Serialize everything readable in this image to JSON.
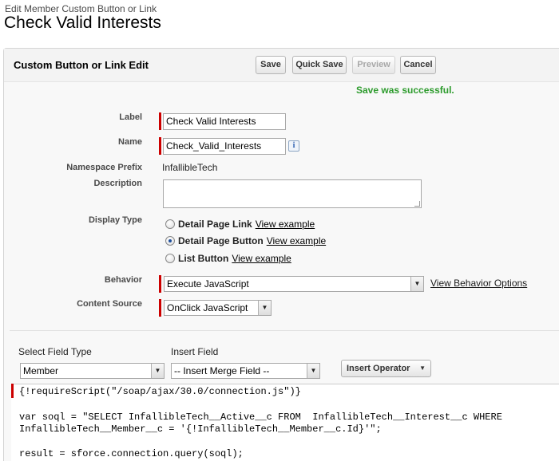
{
  "header": {
    "breadcrumb": "Edit Member Custom Button or Link",
    "title": "Check Valid Interests"
  },
  "panel": {
    "title": "Custom Button or Link Edit",
    "buttons": {
      "save": "Save",
      "quick_save": "Quick Save",
      "preview": "Preview",
      "cancel": "Cancel"
    },
    "success_message": "Save was successful."
  },
  "form": {
    "label": {
      "label": "Label",
      "value": "Check Valid Interests"
    },
    "name": {
      "label": "Name",
      "value": "Check_Valid_Interests",
      "info_icon": "info-icon"
    },
    "namespace": {
      "label": "Namespace Prefix",
      "value": "InfallibleTech"
    },
    "description": {
      "label": "Description",
      "value": ""
    },
    "display_type": {
      "label": "Display Type",
      "options": [
        {
          "label": "Detail Page Link",
          "link": "View example",
          "checked": false
        },
        {
          "label": "Detail Page Button",
          "link": "View example",
          "checked": true
        },
        {
          "label": "List Button",
          "link": "View example",
          "checked": false
        }
      ]
    },
    "behavior": {
      "label": "Behavior",
      "value": "Execute JavaScript",
      "link": "View Behavior Options"
    },
    "content_source": {
      "label": "Content Source",
      "value": "OnClick JavaScript"
    }
  },
  "editor_toolbar": {
    "select_field_type_label": "Select Field Type",
    "select_field_type_value": "Member",
    "insert_field_label": "Insert Field",
    "insert_field_value": "-- Insert Merge Field --",
    "insert_operator": "Insert Operator"
  },
  "code": {
    "lines": [
      "{!requireScript(\"/soap/ajax/30.0/connection.js\")}",
      "",
      "var soql = \"SELECT InfallibleTech__Active__c FROM  InfallibleTech__Interest__c WHERE",
      "InfallibleTech__Member__c = '{!InfallibleTech__Member__c.Id}'\";",
      "",
      "result = sforce.connection.query(soql);"
    ]
  },
  "colors": {
    "required": "#cc0000",
    "success": "#2c9b2c"
  }
}
